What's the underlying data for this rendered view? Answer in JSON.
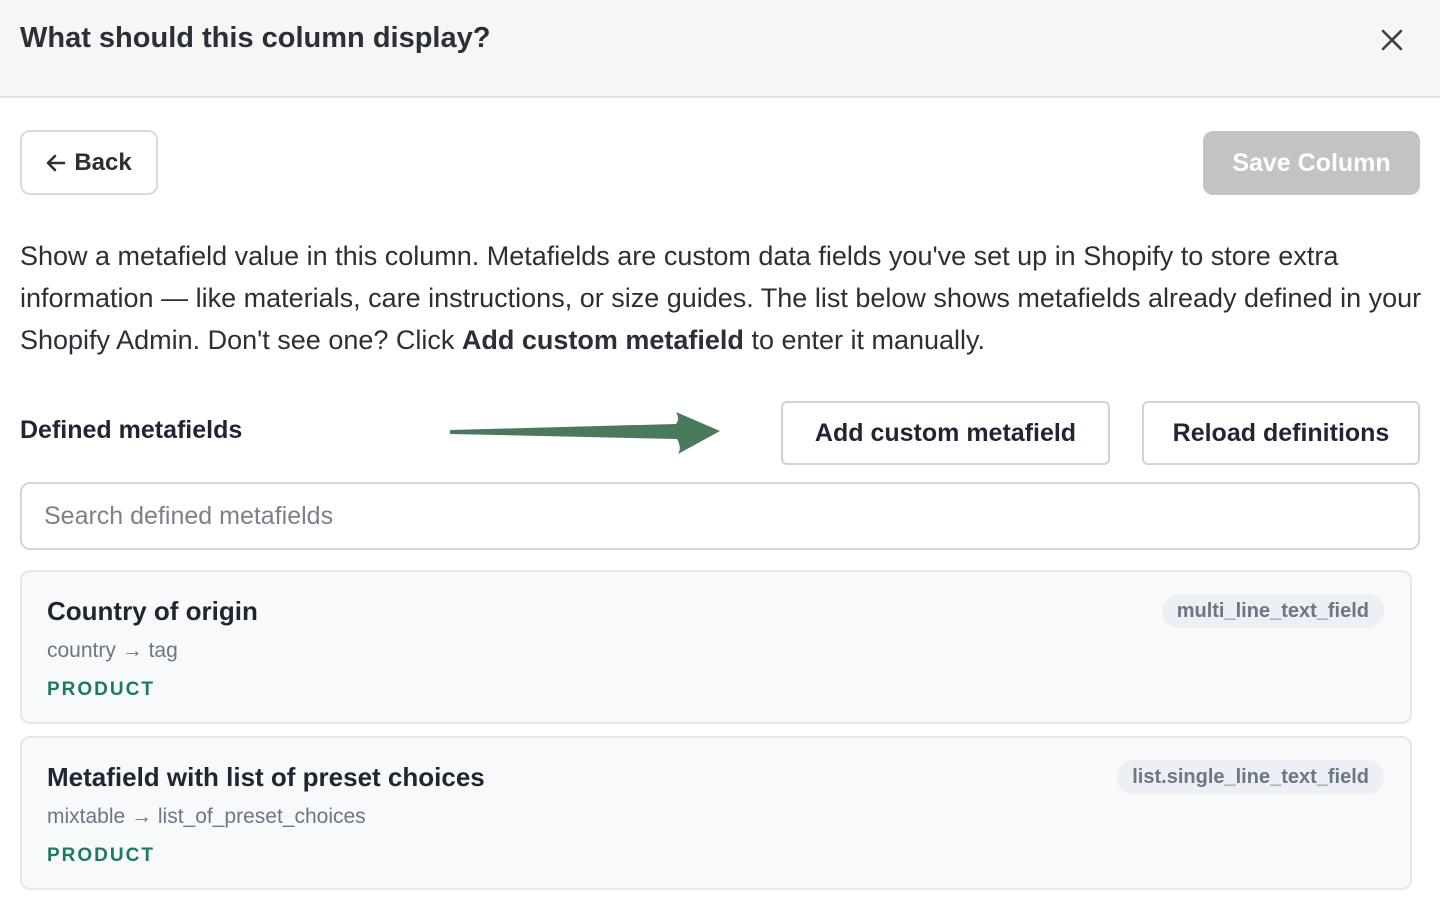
{
  "modal": {
    "title": "What should this column display?"
  },
  "toolbar": {
    "back_label": "Back",
    "save_label": "Save Column"
  },
  "description": {
    "before": "Show a metafield value in this column. Metafields are custom data fields you've set up in Shopify to store extra information — like materials, care instructions, or size guides. The list below shows metafields already defined in your Shopify Admin. Don't see one? Click ",
    "bold": "Add custom metafield",
    "after": " to enter it manually."
  },
  "section": {
    "label": "Defined metafields",
    "add_button": "Add custom metafield",
    "reload_button": "Reload definitions"
  },
  "search": {
    "placeholder": "Search defined metafields",
    "value": ""
  },
  "metafields": [
    {
      "name": "Country of origin",
      "namespace": "country",
      "arrow": "→",
      "key": "tag",
      "owner": "PRODUCT",
      "type": "multi_line_text_field"
    },
    {
      "name": "Metafield with list of preset choices",
      "namespace": "mixtable",
      "arrow": "→",
      "key": "list_of_preset_choices",
      "owner": "PRODUCT",
      "type": "list.single_line_text_field"
    }
  ],
  "icons": {
    "close": "close-icon",
    "back": "arrow-left-icon",
    "annotation": "arrow-right-icon"
  },
  "colors": {
    "header_bg": "#f6f6f6",
    "save_disabled": "#c3c3c3",
    "owner_green": "#1e7a5e",
    "annotation_arrow": "#4a7a5c"
  }
}
